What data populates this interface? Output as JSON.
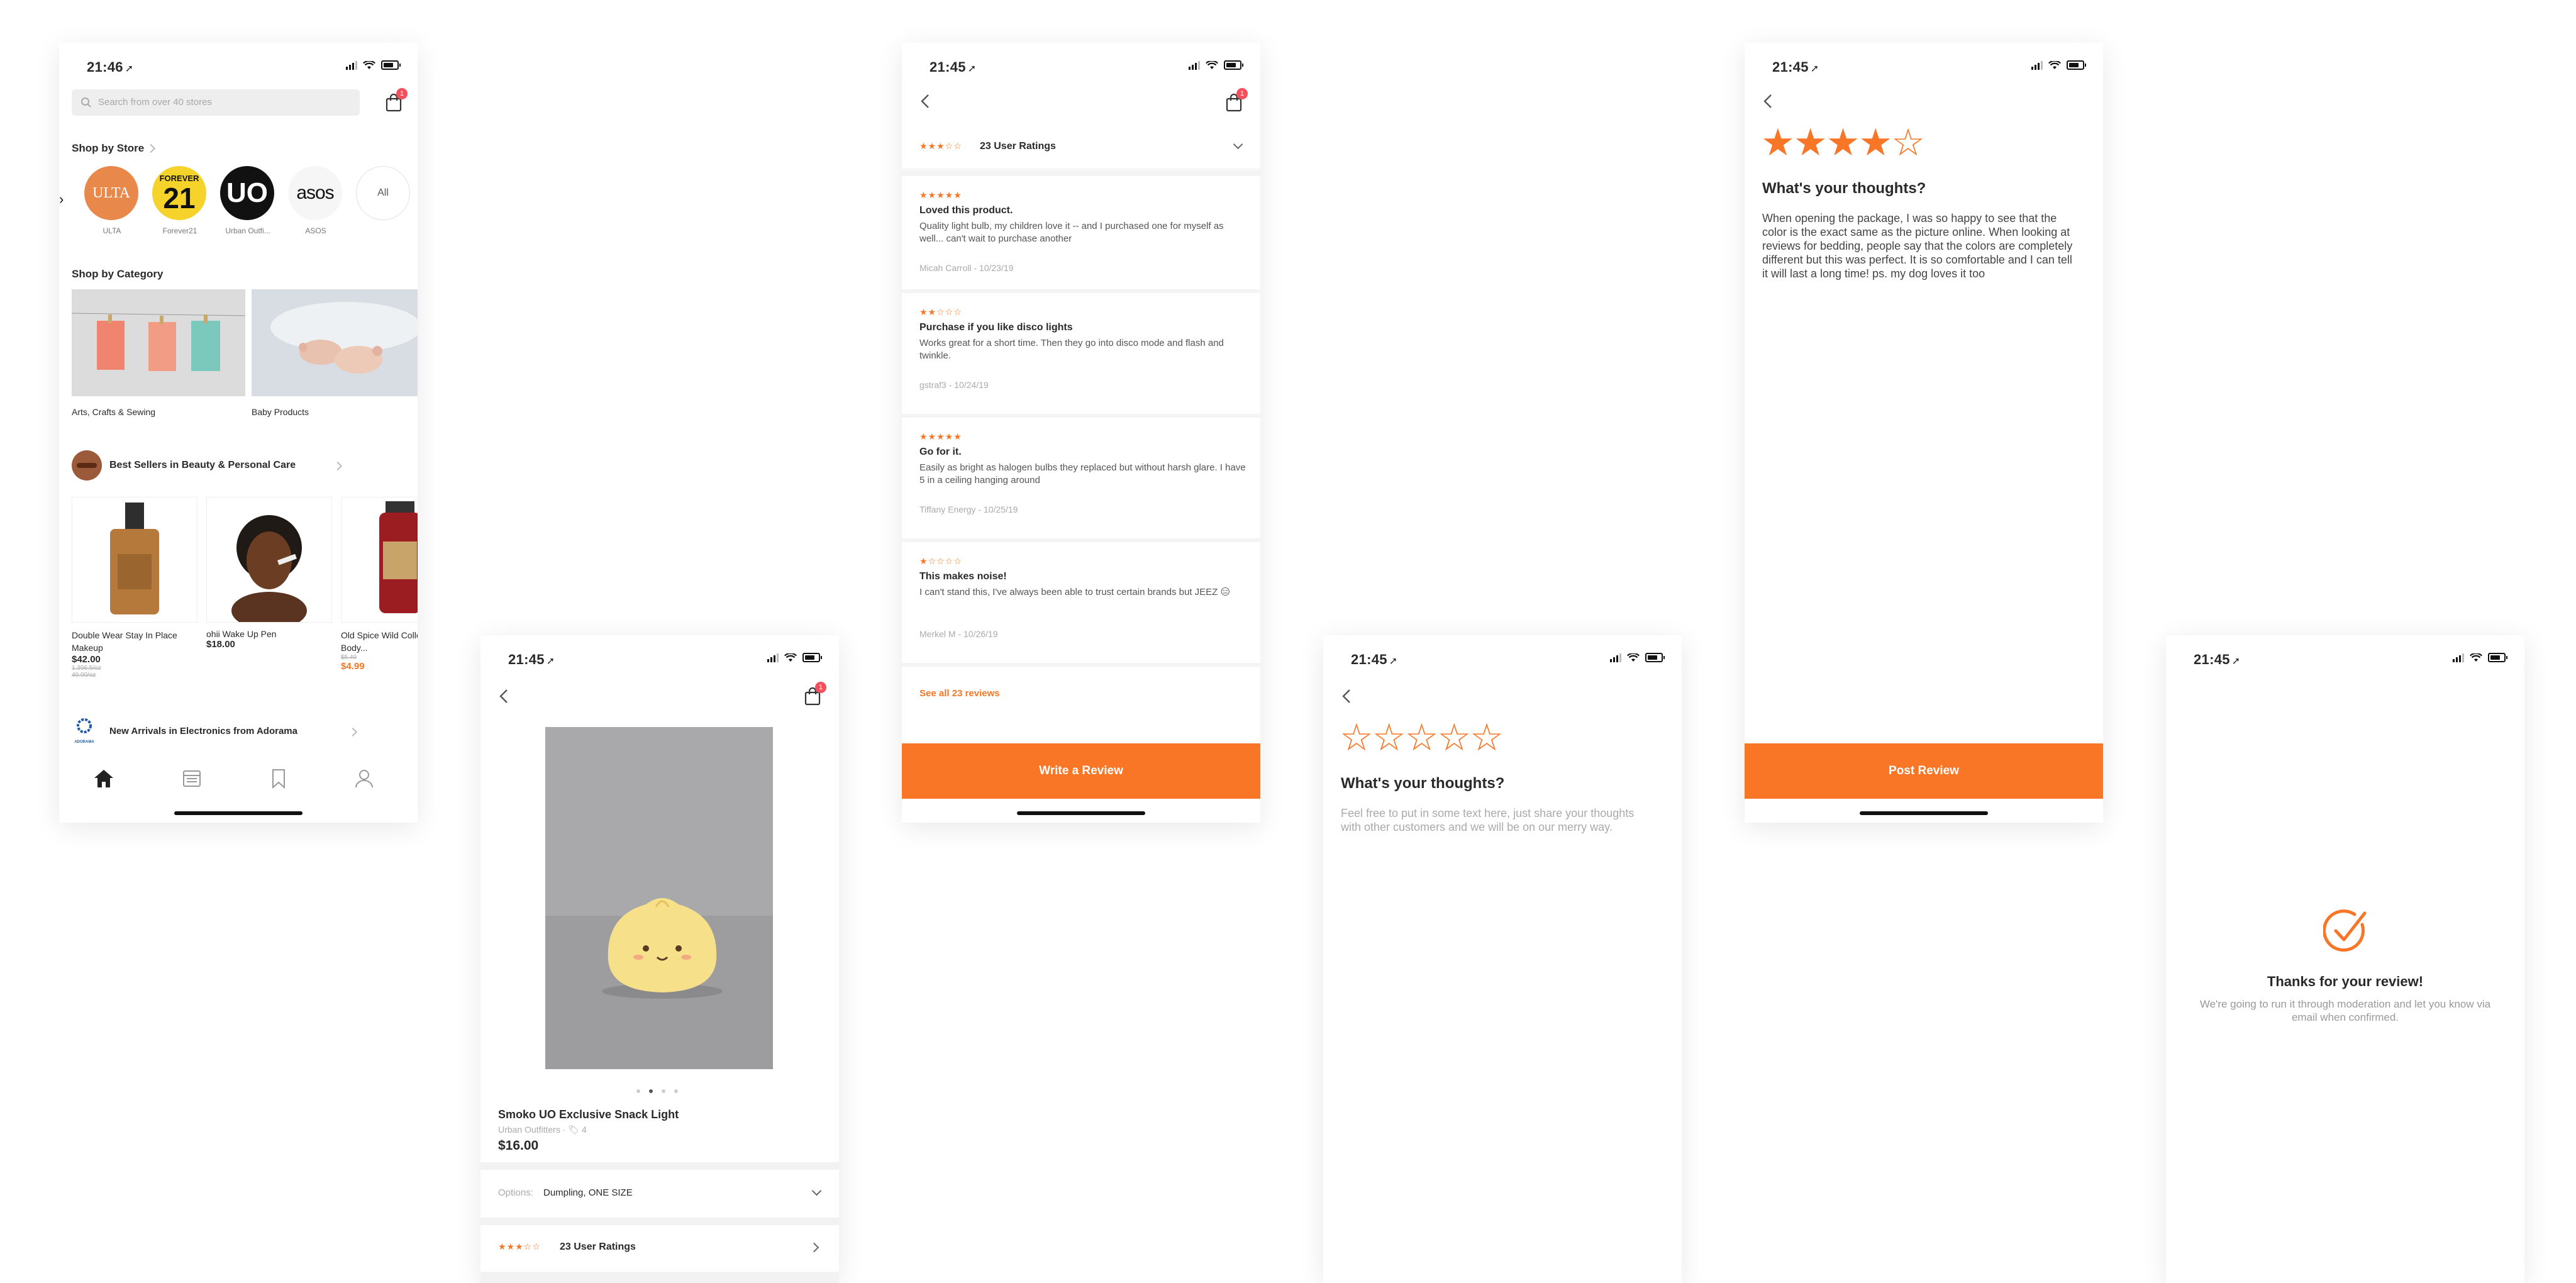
{
  "colors": {
    "accent": "#f97626",
    "badge": "#f2505c",
    "text": "#2a2a2a",
    "muted": "#9b9b9b"
  },
  "status": {
    "time_a": "21:46",
    "time_b": "21:45"
  },
  "cart_badge": "1",
  "home": {
    "search_placeholder": "Search from over 40 stores",
    "shop_by_store": "Shop by Store",
    "stores": [
      {
        "logo": "ULTA",
        "name": "ULTA",
        "color": "#e8884a",
        "text_color": "#ffffff"
      },
      {
        "logo": "21",
        "logo_top": "FOREVER",
        "name": "Forever21",
        "color": "#f6d32b",
        "text_color": "#111111"
      },
      {
        "logo": "UO",
        "name": "Urban Outfi...",
        "color": "#111111",
        "text_color": "#ffffff"
      },
      {
        "logo": "asos",
        "name": "ASOS",
        "color": "#f6f6f6",
        "text_color": "#111111"
      },
      {
        "logo": "All",
        "name": "",
        "color": "#ffffff",
        "text_color": "#555555"
      }
    ],
    "shop_by_category": "Shop by Category",
    "categories": [
      "Arts, Crafts & Sewing",
      "Baby Products"
    ],
    "best_sellers": "Best Sellers in Beauty & Personal Care",
    "products": [
      {
        "name": "Double Wear Stay In Place Makeup",
        "price": "$42.00",
        "old": "1,396.5/oz",
        "old2": "40.00/oz"
      },
      {
        "name": "ohii Wake Up Pen",
        "price": "$18.00",
        "old": "",
        "old2": ""
      },
      {
        "name": "Old Spice Wild Collection Body...",
        "price": "$4.99",
        "old": "$5.49",
        "old2": ""
      }
    ],
    "new_arrivals": "New Arrivals in Electronics from Adorama",
    "adorama_label": "ADORAMA",
    "tabs": [
      "home-icon",
      "calendar-icon",
      "bookmark-icon",
      "profile-icon"
    ]
  },
  "product": {
    "title": "Smoko UO Exclusive Snack Light",
    "store": "Urban Outfitters",
    "count": "4",
    "price": "$16.00",
    "options_label": "Options:",
    "options_value": "Dumpling, ONE SIZE",
    "rating_stars": "★★★☆☆",
    "ratings_text": "23 User Ratings",
    "rating_value": 3
  },
  "reviews": {
    "header_stars": "★★★☆☆",
    "header_text": "23 User Ratings",
    "items": [
      {
        "stars": "★★★★★",
        "rating": 5,
        "title": "Loved this product.",
        "body": "Quality light bulb, my children love it -- and I purchased one for myself as well... can't wait to purchase another",
        "author": "Micah Carroll - 10/23/19"
      },
      {
        "stars": "★★☆☆☆",
        "rating": 2,
        "title": "Purchase if you like disco lights",
        "body": "Works great for a short time. Then they go into disco mode and flash and twinkle.",
        "author": "gstraf3 - 10/24/19"
      },
      {
        "stars": "★★★★★",
        "rating": 5,
        "title": "Go for it.",
        "body": "Easily as bright as halogen bulbs they replaced but without harsh glare. I have 5 in a ceiling hanging around",
        "author": "Tiffany Energy - 10/25/19"
      },
      {
        "stars": "★☆☆☆☆",
        "rating": 1,
        "title": "This makes noise!",
        "body": "I can't stand this, I've always been able to trust certain brands but JEEZ 😑",
        "author": "Merkel M - 10/26/19"
      }
    ],
    "see_all": "See all 23 reviews",
    "write_button": "Write a Review"
  },
  "write_empty": {
    "stars": "☆☆☆☆☆",
    "rating": 0,
    "heading": "What's your thoughts?",
    "placeholder": "Feel free to put in some text here, just share your thoughts with other customers and we will be on our merry way."
  },
  "write_filled": {
    "stars": "★★★★☆",
    "rating": 4,
    "heading": "What's your thoughts?",
    "text": "When opening the package, I was so happy to see that the color is the exact same as the picture online. When looking at reviews for bedding, people say that the colors are completely different but this was perfect. It is so comfortable and I can tell it will last a long time! ps. my dog loves it too",
    "post_button": "Post Review"
  },
  "thanks": {
    "heading": "Thanks for your review!",
    "body": "We're going to run it through moderation and let you know via email when confirmed."
  }
}
